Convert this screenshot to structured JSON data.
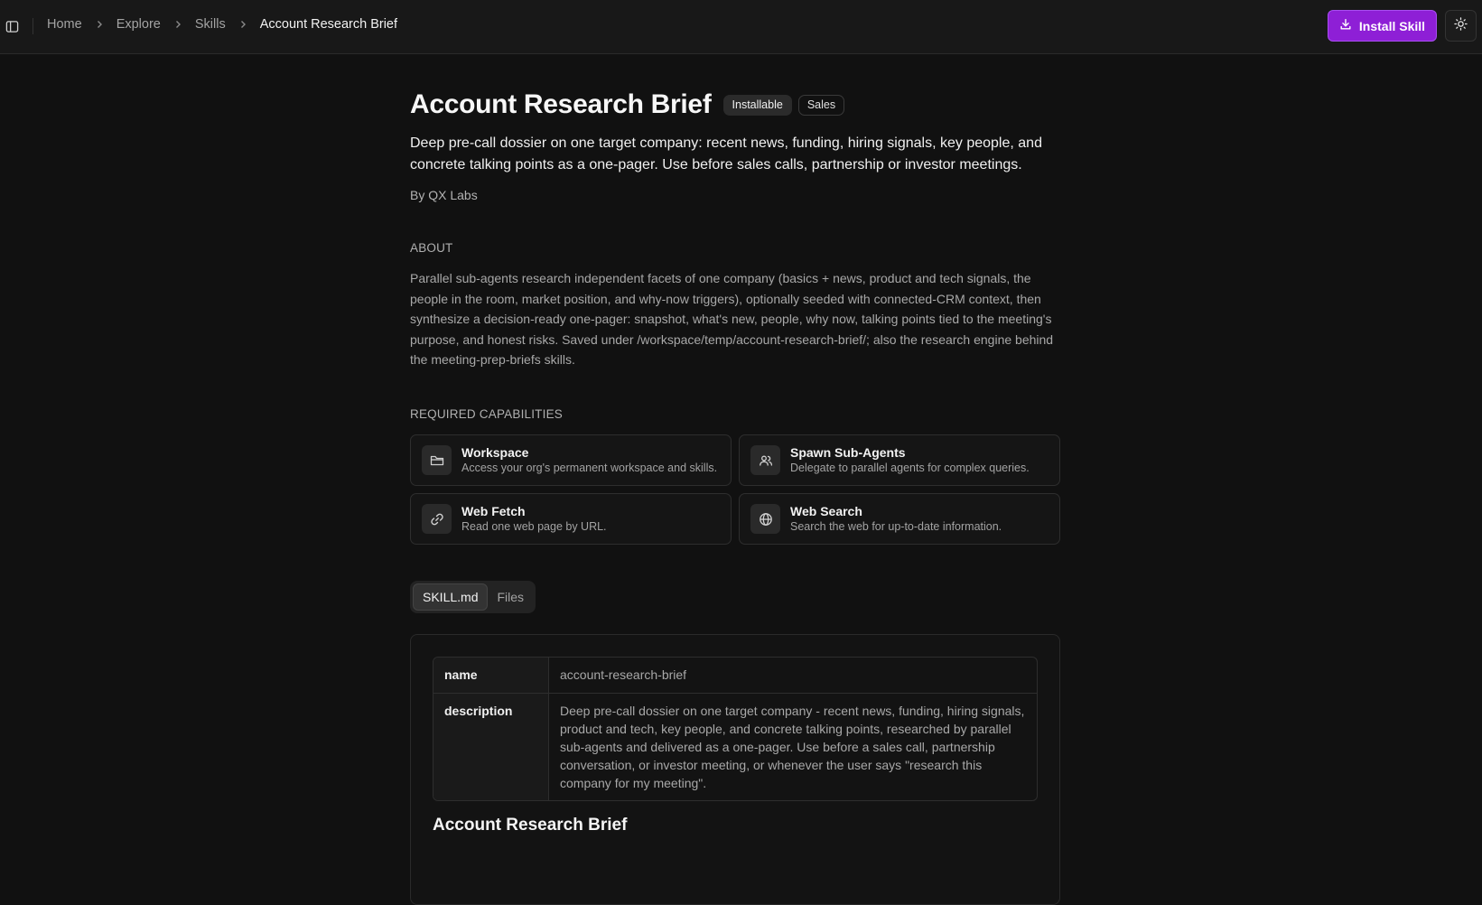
{
  "topbar": {
    "breadcrumb": [
      "Home",
      "Explore",
      "Skills",
      "Account Research Brief"
    ],
    "install_label": "Install Skill",
    "accent": "#8e1fd6"
  },
  "skill": {
    "title": "Account Research Brief",
    "badges": [
      "Installable",
      "Sales"
    ],
    "summary": "Deep pre-call dossier on one target company: recent news, funding, hiring signals, key people, and concrete talking points as a one-pager. Use before sales calls, partnership or investor meetings.",
    "author": "By QX Labs"
  },
  "about": {
    "label": "ABOUT",
    "text": "Parallel sub-agents research independent facets of one company (basics + news, product and tech signals, the people in the room, market position, and why-now triggers), optionally seeded with connected-CRM context, then synthesize a decision-ready one-pager: snapshot, what's new, people, why now, talking points tied to the meeting's purpose, and honest risks. Saved under /workspace/temp/account-research-brief/; also the research engine behind the meeting-prep-briefs skills."
  },
  "capabilities": {
    "label": "REQUIRED CAPABILITIES",
    "items": [
      {
        "icon": "folder-icon",
        "title": "Workspace",
        "desc": "Access your org's permanent workspace and skills."
      },
      {
        "icon": "users-icon",
        "title": "Spawn Sub-Agents",
        "desc": "Delegate to parallel agents for complex queries."
      },
      {
        "icon": "link-icon",
        "title": "Web Fetch",
        "desc": "Read one web page by URL."
      },
      {
        "icon": "globe-icon",
        "title": "Web Search",
        "desc": "Search the web for up-to-date information."
      }
    ]
  },
  "tabs": [
    "SKILL.md",
    "Files"
  ],
  "document": {
    "frontmatter": [
      {
        "key": "name",
        "value": "account-research-brief"
      },
      {
        "key": "description",
        "value": "Deep pre-call dossier on one target company - recent news, funding, hiring signals, product and tech, key people, and concrete talking points, researched by parallel sub-agents and delivered as a one-pager. Use before a sales call, partnership conversation, or investor meeting, or whenever the user says \"research this company for my meeting\"."
      }
    ],
    "heading": "Account Research Brief"
  }
}
